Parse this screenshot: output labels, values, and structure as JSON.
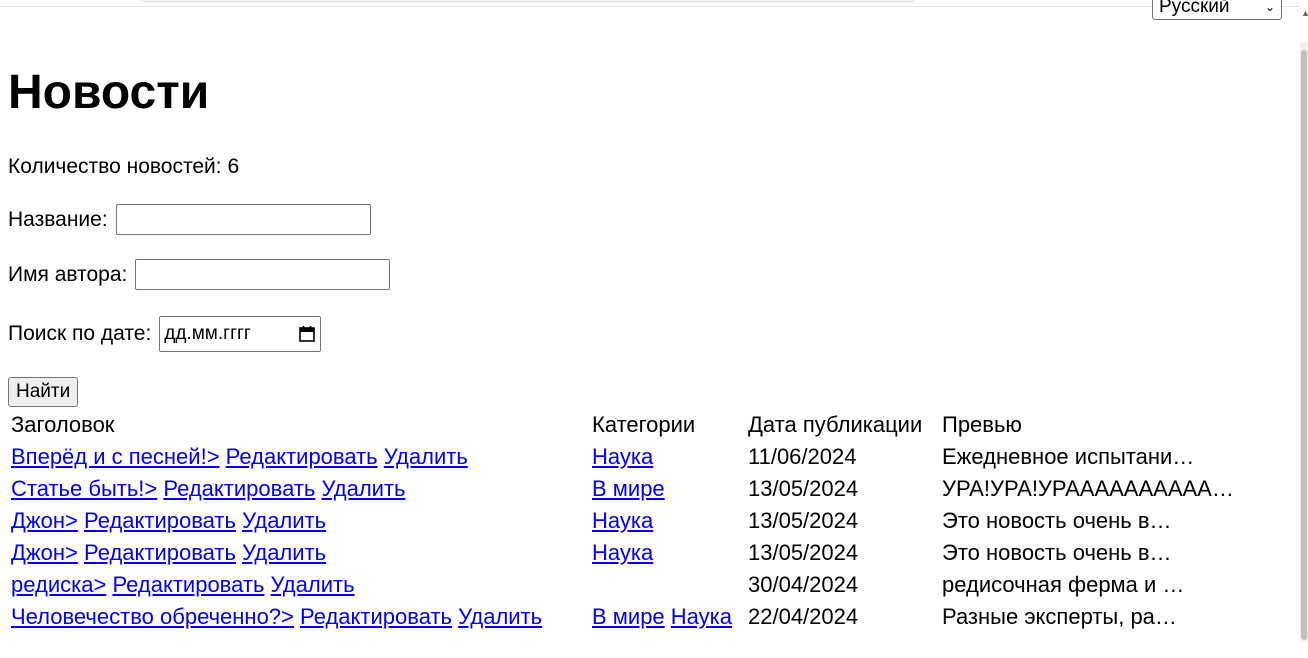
{
  "language_select": {
    "value": "Русский"
  },
  "page_title": "Новости",
  "news_count": "Количество новостей: 6",
  "search": {
    "title_label": "Название:",
    "title_value": "",
    "author_label": "Имя автора:",
    "author_value": "",
    "date_label": "Поиск по дате:",
    "date_placeholder": "дд.мм.гггг",
    "find_button": "Найти"
  },
  "table": {
    "headers": [
      "Заголовок",
      "Категории",
      "Дата публикации",
      "Превью"
    ],
    "rows": [
      {
        "title": "Вперёд и с песней!>",
        "edit": "Редактировать",
        "delete": "Удалить",
        "categories": [
          "Наука"
        ],
        "date": "11/06/2024",
        "preview": "Ежедневное испытани…"
      },
      {
        "title": "Статье быть!>",
        "edit": "Редактировать",
        "delete": "Удалить",
        "categories": [
          "В мире"
        ],
        "date": "13/05/2024",
        "preview": "УРА!УРА!УРАААААААААА…"
      },
      {
        "title": "Джон>",
        "edit": "Редактировать",
        "delete": "Удалить",
        "categories": [
          "Наука"
        ],
        "date": "13/05/2024",
        "preview": "Это новость очень в…"
      },
      {
        "title": "Джон>",
        "edit": "Редактировать",
        "delete": "Удалить",
        "categories": [
          "Наука"
        ],
        "date": "13/05/2024",
        "preview": "Это новость очень в…"
      },
      {
        "title": "редиска>",
        "edit": "Редактировать",
        "delete": "Удалить",
        "categories": [],
        "date": "30/04/2024",
        "preview": "редисочная ферма и …"
      },
      {
        "title": "Человечество обреченно?>",
        "edit": "Редактировать",
        "delete": "Удалить",
        "categories": [
          "В мире",
          "Наука"
        ],
        "date": "22/04/2024",
        "preview": "Разные эксперты, ра…"
      }
    ]
  },
  "colors": {
    "link": "#0000ee",
    "button_bg": "#efefef",
    "border": "#767676"
  }
}
